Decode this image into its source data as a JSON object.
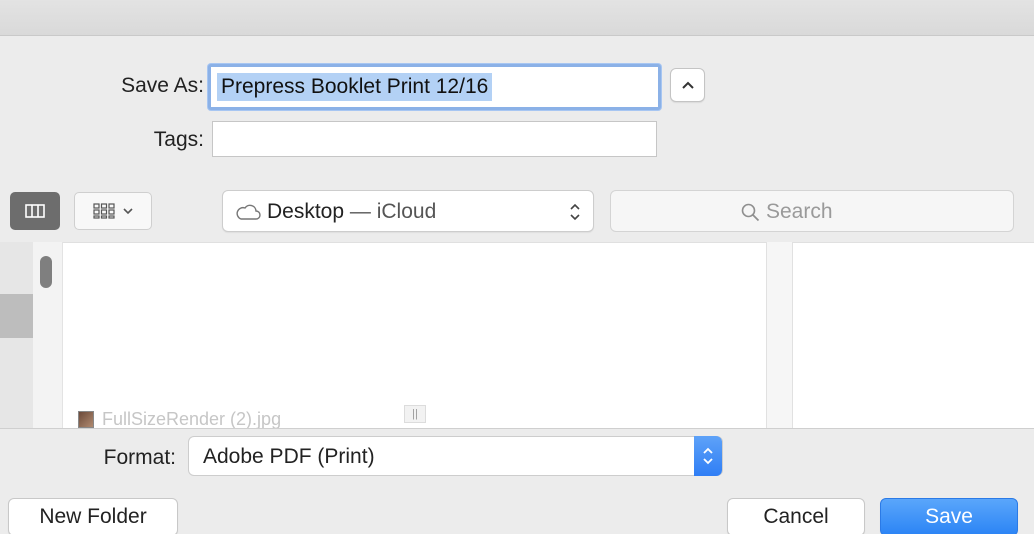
{
  "save_as": {
    "label": "Save As:",
    "value": "Prepress Booklet Print 12/16"
  },
  "tags": {
    "label": "Tags:",
    "value": ""
  },
  "toolbar": {
    "location_name": "Desktop",
    "location_separator": " — ",
    "location_service": "iCloud",
    "search_placeholder": "Search"
  },
  "browser": {
    "files": [
      {
        "name": "FullSizeRender (2).jpg",
        "icon": "image-thumbnail-icon"
      }
    ]
  },
  "format": {
    "label": "Format:",
    "value": "Adobe PDF (Print)"
  },
  "buttons": {
    "new_folder": "New Folder",
    "cancel": "Cancel",
    "save": "Save"
  },
  "colors": {
    "accent": "#2b84f5",
    "selection": "#b3d1f5",
    "focus_ring": "#8bb1e7"
  }
}
